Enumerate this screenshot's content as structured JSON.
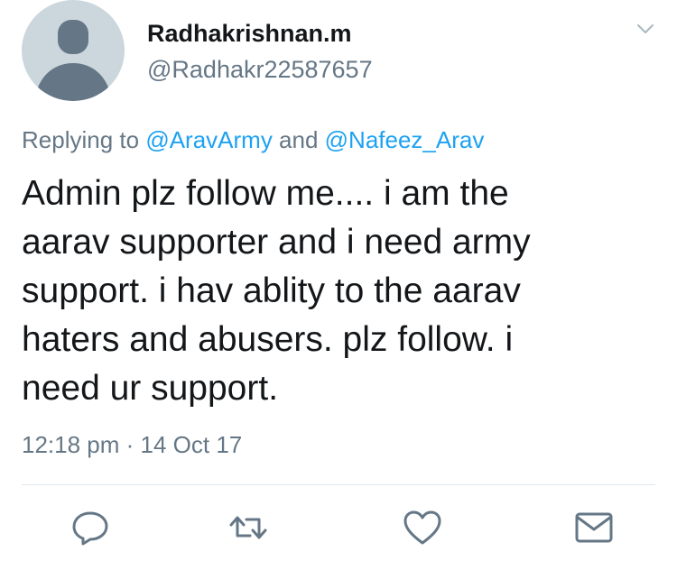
{
  "tweet": {
    "author": {
      "display_name": "Radhakrishnan.m",
      "handle": "@Radhakr22587657"
    },
    "reply": {
      "prefix": "Replying to ",
      "mention_1": "@AravArmy",
      "conjunction": " and ",
      "mention_2": "@Nafeez_Arav"
    },
    "text": "Admin plz follow me.... i am the\naarav supporter and i need army\nsupport. i hav ablity to the aarav\nhaters and abusers.  plz follow. i\nneed ur support.",
    "timestamp": "12:18 pm · 14 Oct 17"
  },
  "icons": {
    "avatar": "default-avatar-icon",
    "menu": "chevron-down-icon",
    "reply": "reply-icon",
    "retweet": "retweet-icon",
    "like": "heart-icon",
    "message": "envelope-icon"
  },
  "colors": {
    "link": "#1da1f2",
    "secondary_text": "#657786",
    "icon": "#657786",
    "avatar_bg": "#ccd6dd",
    "avatar_fg": "#657786"
  }
}
